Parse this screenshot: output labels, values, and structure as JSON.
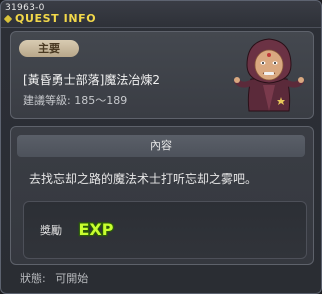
{
  "window": {
    "quest_id": "31963-0",
    "title": "QUEST INFO"
  },
  "quest": {
    "category_badge": "主要",
    "name": "[黃昏勇士部落]魔法冶煉2",
    "level_label": "建議等級:",
    "level_range": "185～189"
  },
  "content": {
    "header": "內容",
    "description": "去找忘却之路的魔法术士打听忘却之雾吧。"
  },
  "reward": {
    "label": "獎勵",
    "icon": "exp-icon",
    "icon_text": "EXP"
  },
  "status": {
    "label": "狀態:",
    "value": "可開始"
  },
  "colors": {
    "title": "#f2d84a",
    "badge_bg": "#c9baa0",
    "exp_fill": "#c8ff2f",
    "exp_outline": "#2b5a0a"
  },
  "npc": {
    "icon": "hooded-wizard-npc-icon"
  }
}
